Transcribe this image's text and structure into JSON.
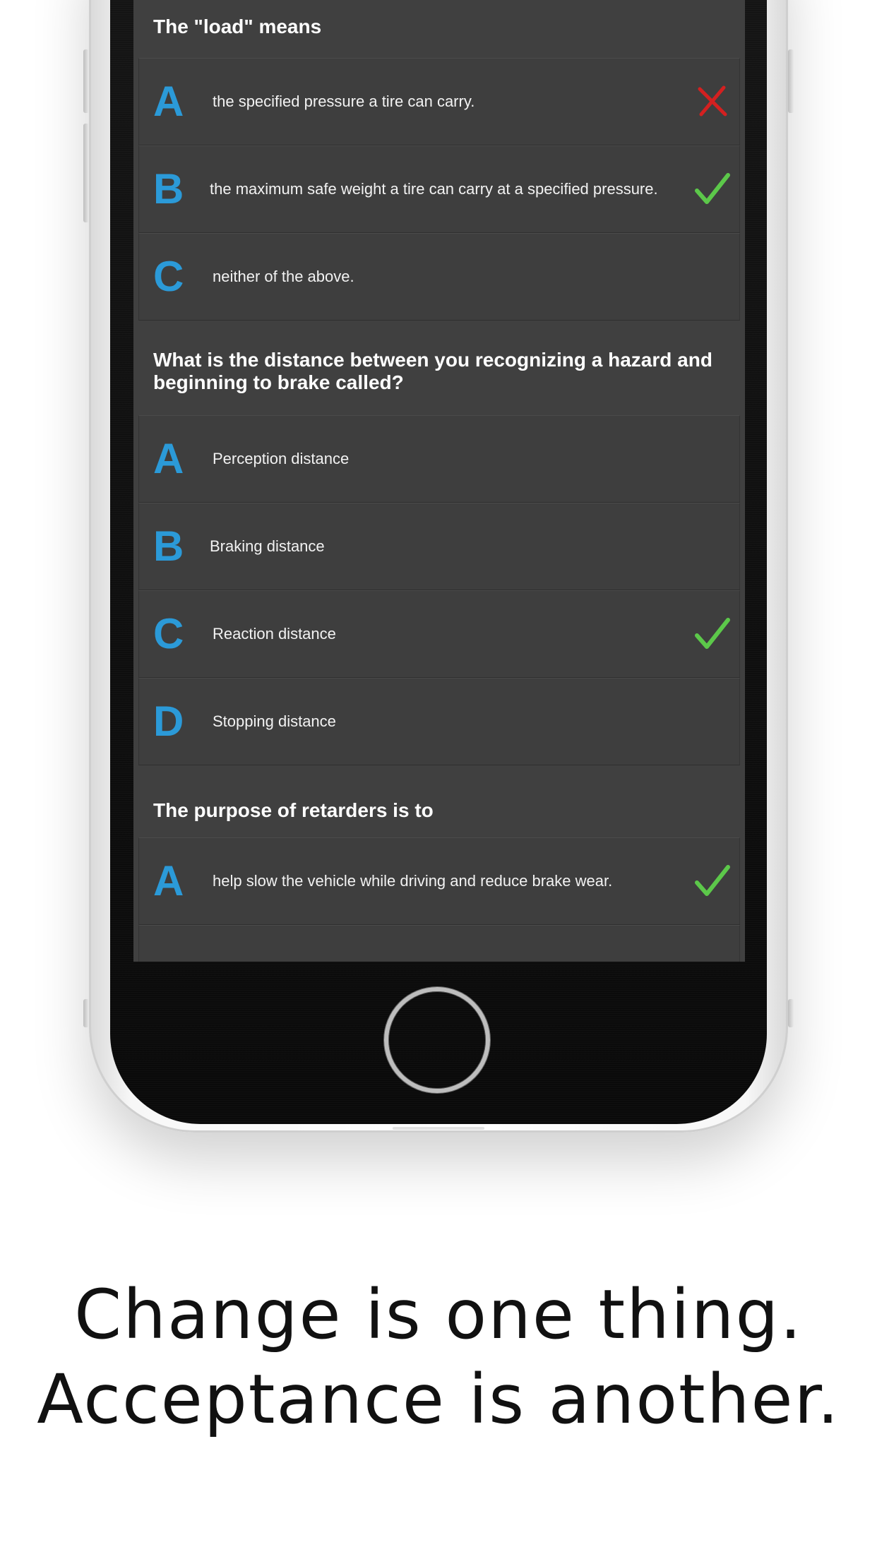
{
  "questions": [
    {
      "text": "The \"load\" means",
      "answers": [
        {
          "letter": "A",
          "text": "the specified pressure a tire can carry.",
          "mark": "cross-icon"
        },
        {
          "letter": "B",
          "text": "the maximum safe weight a tire can carry at a specified pressure.",
          "mark": "check-icon"
        },
        {
          "letter": "C",
          "text": "neither of the above.",
          "mark": ""
        }
      ]
    },
    {
      "text": "What is the distance between you recognizing a hazard and beginning to brake called?",
      "answers": [
        {
          "letter": "A",
          "text": "Perception distance",
          "mark": ""
        },
        {
          "letter": "B",
          "text": "Braking distance",
          "mark": ""
        },
        {
          "letter": "C",
          "text": "Reaction distance",
          "mark": "check-icon"
        },
        {
          "letter": "D",
          "text": "Stopping distance",
          "mark": ""
        }
      ]
    },
    {
      "text": "The purpose of retarders is to",
      "answers": [
        {
          "letter": "A",
          "text": "help slow the vehicle while driving and reduce brake wear.",
          "mark": "check-icon"
        },
        {
          "letter": "B",
          "text": "",
          "mark": ""
        }
      ]
    }
  ],
  "caption": {
    "line1": "Change is one thing.",
    "line2": "Acceptance is another."
  },
  "colors": {
    "letter": "#2b9ad8",
    "check": "#5cc84a",
    "cross": "#d42020",
    "screen_bg": "#404040"
  }
}
